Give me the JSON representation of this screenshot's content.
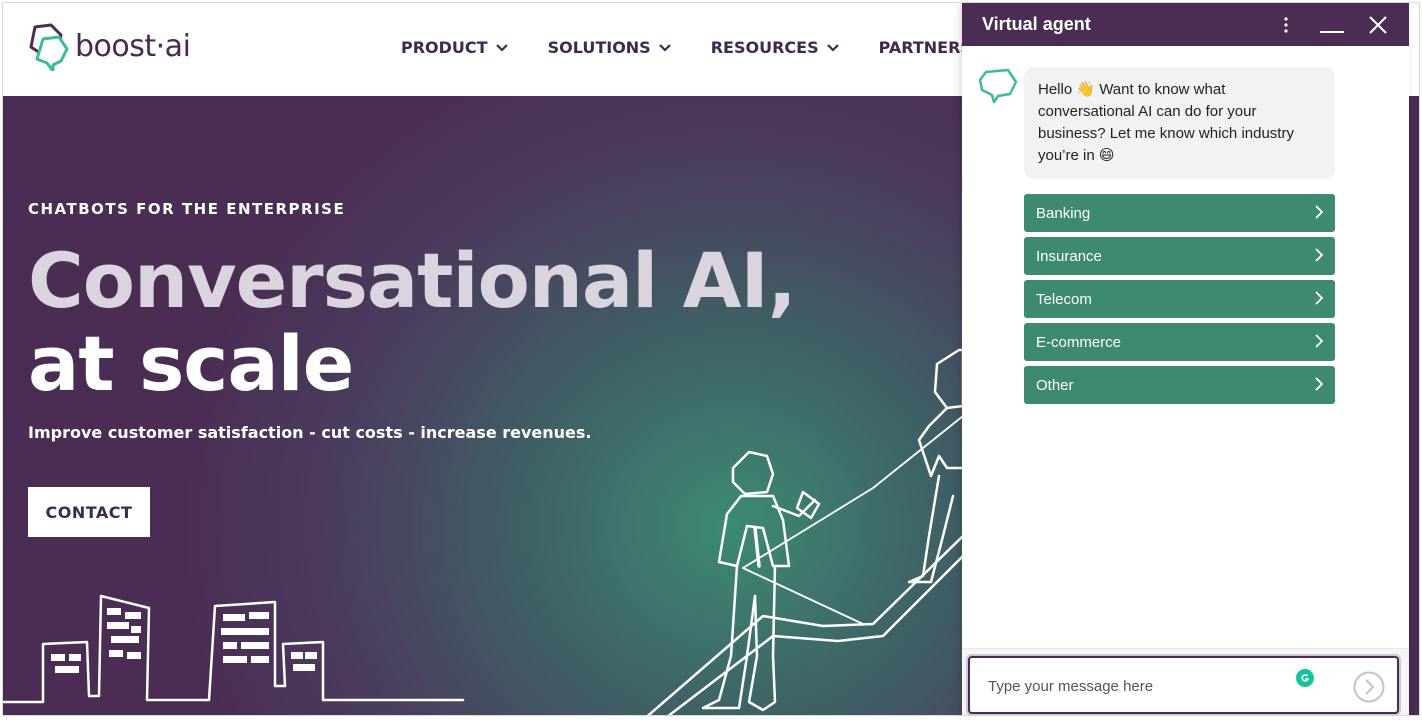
{
  "site": {
    "logo_text": "boost·ai",
    "nav": [
      {
        "label": "PRODUCT"
      },
      {
        "label": "SOLUTIONS"
      },
      {
        "label": "RESOURCES"
      },
      {
        "label": "PARTNERS"
      }
    ]
  },
  "hero": {
    "eyebrow": "CHATBOTS FOR THE ENTERPRISE",
    "title_line1": "Conversational AI,",
    "title_line2": "at scale",
    "subtitle": "Improve customer satisfaction - cut costs - increase revenues.",
    "cta_label": "CONTACT"
  },
  "chat": {
    "title": "Virtual agent",
    "message": "Hello 👋 Want to know what conversational AI can do for your business? Let me know which industry you’re in 😄",
    "options": [
      {
        "label": "Banking"
      },
      {
        "label": "Insurance"
      },
      {
        "label": "Telecom"
      },
      {
        "label": "E-commerce"
      },
      {
        "label": "Other"
      }
    ],
    "input_placeholder": "Type your message here",
    "input_value": ""
  },
  "colors": {
    "brand_purple": "#4b2c53",
    "brand_green": "#3d8a6e",
    "grammarly_green": "#15c39a"
  },
  "icons": [
    "boost-logo-icon",
    "chevron-down-icon",
    "more-vertical-icon",
    "minimize-icon",
    "close-icon",
    "bot-avatar-icon",
    "chevron-right-icon",
    "grammarly-icon",
    "send-icon"
  ]
}
